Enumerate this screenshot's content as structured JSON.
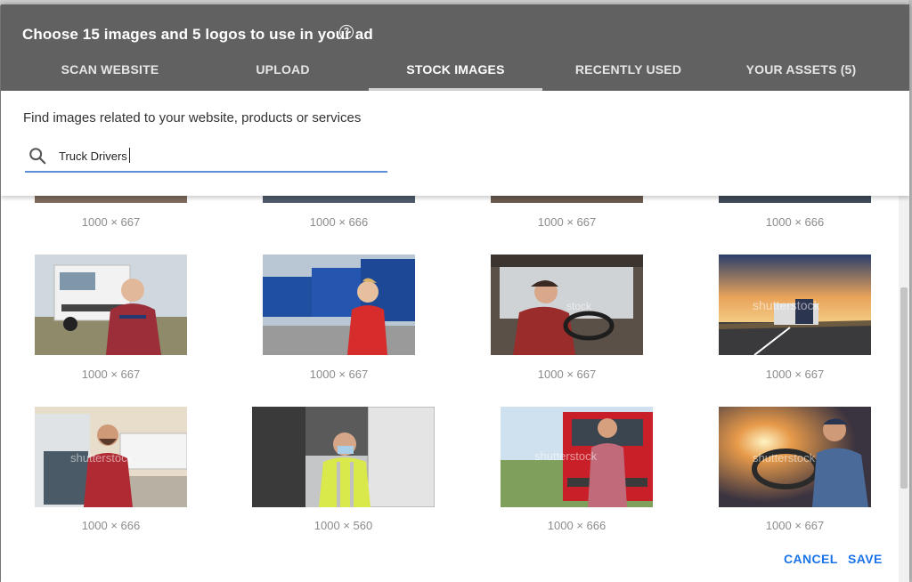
{
  "dialog": {
    "title": "Choose 15 images and 5 logos to use in your ad",
    "help_icon": "question-circle-icon"
  },
  "tabs": [
    {
      "label": "SCAN WEBSITE",
      "active": false
    },
    {
      "label": "UPLOAD",
      "active": false
    },
    {
      "label": "STOCK IMAGES",
      "active": true
    },
    {
      "label": "RECENTLY USED",
      "active": false
    },
    {
      "label": "YOUR ASSETS (5)",
      "active": false
    }
  ],
  "search": {
    "hint": "Find images related to your website, products or services",
    "value": "Truck Drivers",
    "icon": "search-icon"
  },
  "images": [
    {
      "dims": "1000 × 667"
    },
    {
      "dims": "1000 × 666"
    },
    {
      "dims": "1000 × 667"
    },
    {
      "dims": "1000 × 666"
    },
    {
      "dims": "1000 × 667",
      "subject": "driver-with-white-truck"
    },
    {
      "dims": "1000 × 667",
      "subject": "woman-driver-with-blue-trucks"
    },
    {
      "dims": "1000 × 667",
      "subject": "driver-in-cab",
      "watermark": "shutterstock"
    },
    {
      "dims": "1000 × 667",
      "subject": "truck-on-highway-sunset",
      "watermark": "shutterstock"
    },
    {
      "dims": "1000 × 666",
      "subject": "bearded-driver-white-trucks",
      "watermark": "shutterstock"
    },
    {
      "dims": "1000 × 560",
      "subject": "driver-in-hi-vis-mask"
    },
    {
      "dims": "1000 × 666",
      "subject": "driver-with-red-truck",
      "watermark": "shutterstock"
    },
    {
      "dims": "1000 × 667",
      "subject": "driver-steering-sunlight",
      "watermark": "shutterstock"
    }
  ],
  "footer": {
    "cancel_label": "CANCEL",
    "save_label": "SAVE"
  },
  "colors": {
    "header_bg": "#616161",
    "accent_blue": "#1a73e8",
    "search_underline": "#5b8fd6"
  }
}
